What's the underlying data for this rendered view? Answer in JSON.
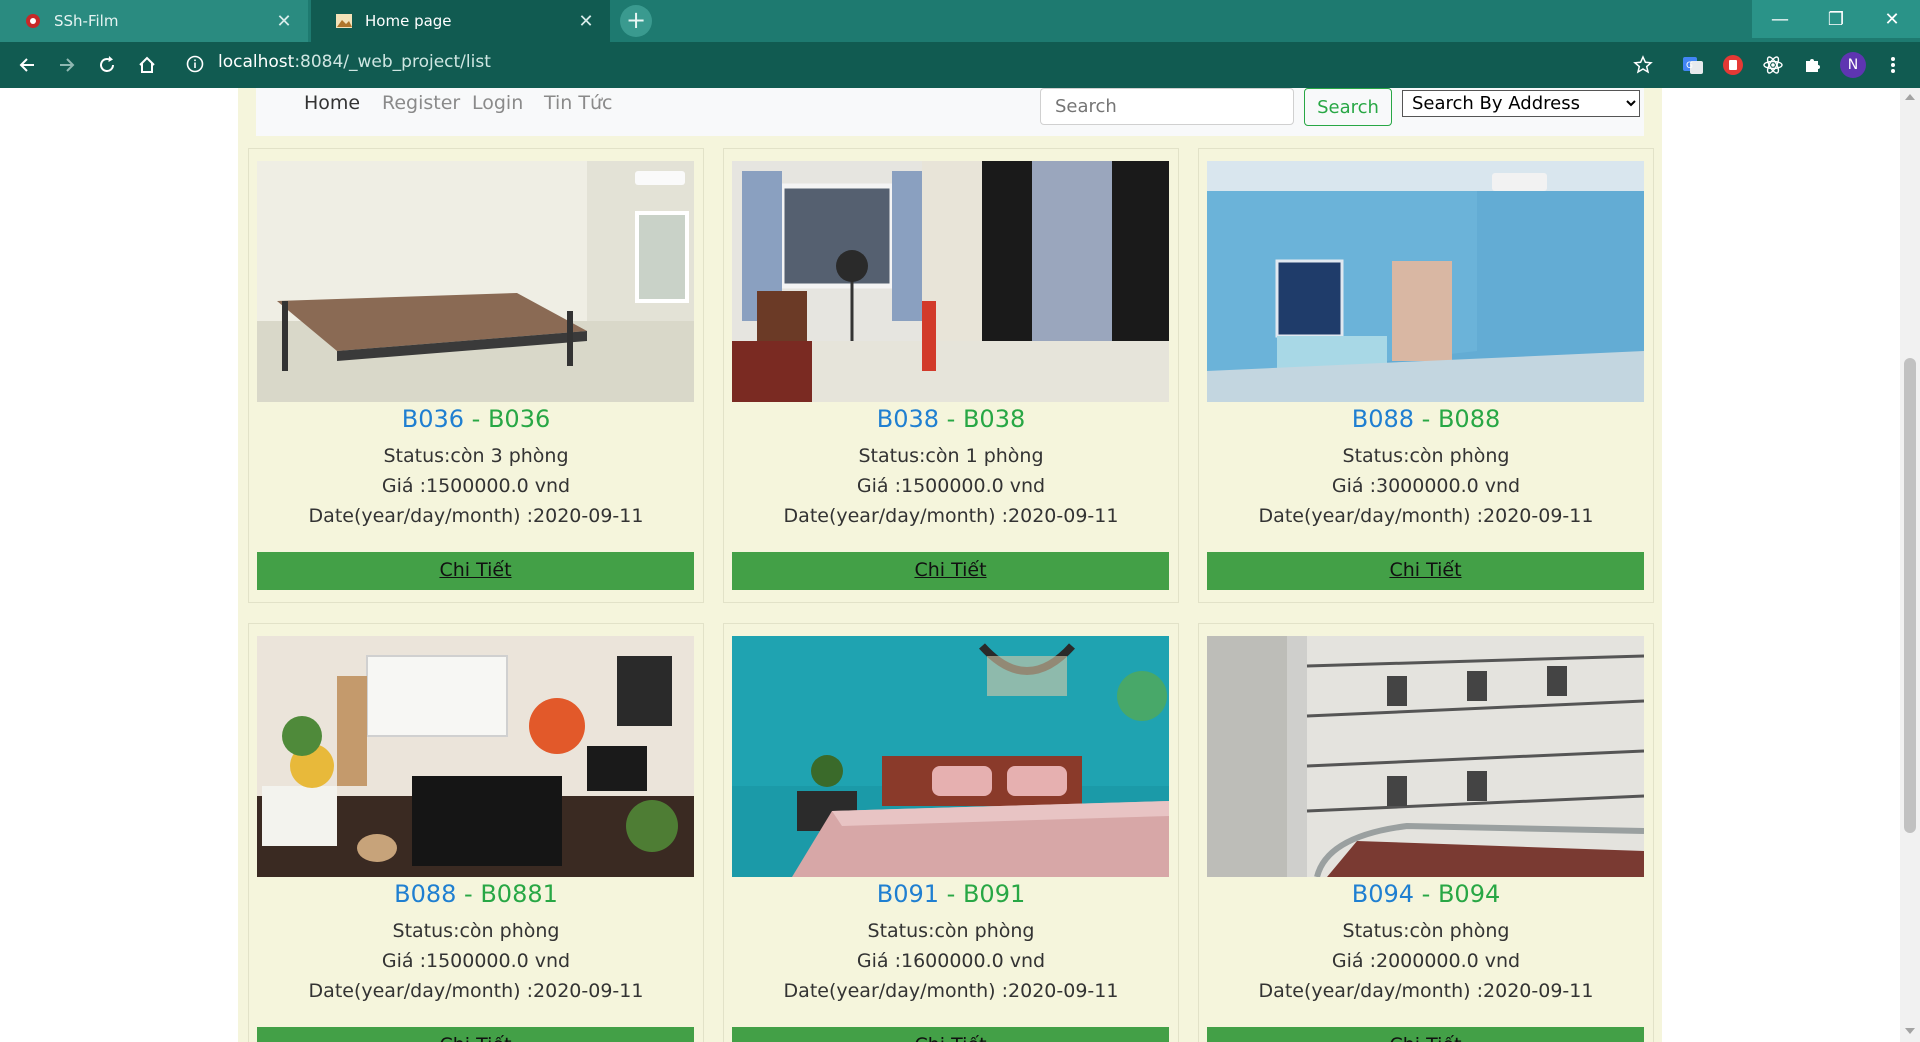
{
  "browser": {
    "tabs": [
      {
        "title": "SSh-Film",
        "active": false
      },
      {
        "title": "Home page",
        "active": true
      }
    ],
    "url_host": "localhost",
    "url_path": ":8084/_web_project/list",
    "profile_initial": "N"
  },
  "nav": {
    "links": [
      "Home",
      "Register",
      "Login",
      "Tin Tức"
    ],
    "search_placeholder": "Search",
    "search_button": "Search",
    "search_select": "Search By Address"
  },
  "cards": [
    {
      "id": "B036",
      "code": "B036",
      "status": "Status:còn 3 phòng",
      "price": "Giá :1500000.0 vnd",
      "date": "Date(year/day/month) :2020-09-11",
      "button": "Chi Tiết"
    },
    {
      "id": "B038",
      "code": "B038",
      "status": "Status:còn 1 phòng",
      "price": "Giá :1500000.0 vnd",
      "date": "Date(year/day/month) :2020-09-11",
      "button": "Chi Tiết"
    },
    {
      "id": "B088",
      "code": "B088",
      "status": "Status:còn phòng",
      "price": "Giá :3000000.0 vnd",
      "date": "Date(year/day/month) :2020-09-11",
      "button": "Chi Tiết"
    },
    {
      "id": "B088",
      "code": "B0881",
      "status": "Status:còn phòng",
      "price": "Giá :1500000.0 vnd",
      "date": "Date(year/day/month) :2020-09-11",
      "button": "Chi Tiết"
    },
    {
      "id": "B091",
      "code": "B091",
      "status": "Status:còn phòng",
      "price": "Giá :1600000.0 vnd",
      "date": "Date(year/day/month) :2020-09-11",
      "button": "Chi Tiết"
    },
    {
      "id": "B094",
      "code": "B094",
      "status": "Status:còn phòng",
      "price": "Giá :2000000.0 vnd",
      "date": "Date(year/day/month) :2020-09-11",
      "button": "Chi Tiết"
    }
  ],
  "separator": " - ",
  "colors": {
    "chrome": "#115b51",
    "page_bg": "#f5f5dc",
    "title_blue": "#1f7fd1",
    "accent_green": "#28a745",
    "button_green": "#43a047"
  }
}
